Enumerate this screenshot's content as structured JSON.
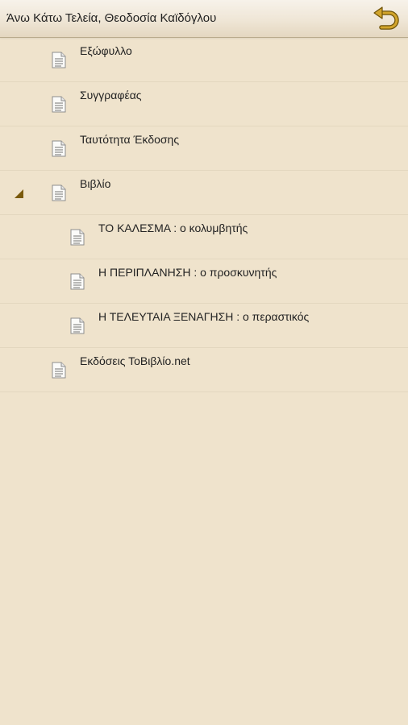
{
  "header": {
    "title": "Άνω Κάτω Τελεία, Θεοδοσία Καϊδόγλου",
    "back_icon": "back-arrow-icon"
  },
  "colors": {
    "background": "#efe3cc",
    "accent": "#a07a10",
    "divider": "#e3d7bf"
  },
  "toc": {
    "items": [
      {
        "label": "Εξώφυλλο",
        "level": 0,
        "icon": "document-icon"
      },
      {
        "label": "Συγγραφέας",
        "level": 0,
        "icon": "document-icon"
      },
      {
        "label": "Ταυτότητα Έκδοσης",
        "level": 0,
        "icon": "document-icon"
      },
      {
        "label": "Βιβλίο",
        "level": 0,
        "icon": "document-icon",
        "expanded": true
      },
      {
        "label": "ΤΟ ΚΑΛΕΣΜΑ : ο κολυμβητής",
        "level": 1,
        "icon": "document-icon"
      },
      {
        "label": "Η ΠΕΡΙΠΛΑΝΗΣΗ : ο προσκυνητής",
        "level": 1,
        "icon": "document-icon"
      },
      {
        "label": "Η ΤΕΛΕΥΤΑΙΑ ΞΕΝΑΓΗΣΗ : ο περαστικός",
        "level": 1,
        "icon": "document-icon"
      },
      {
        "label": "Εκδόσεις ΤοΒιβλίο.net",
        "level": 0,
        "icon": "document-icon"
      }
    ]
  }
}
